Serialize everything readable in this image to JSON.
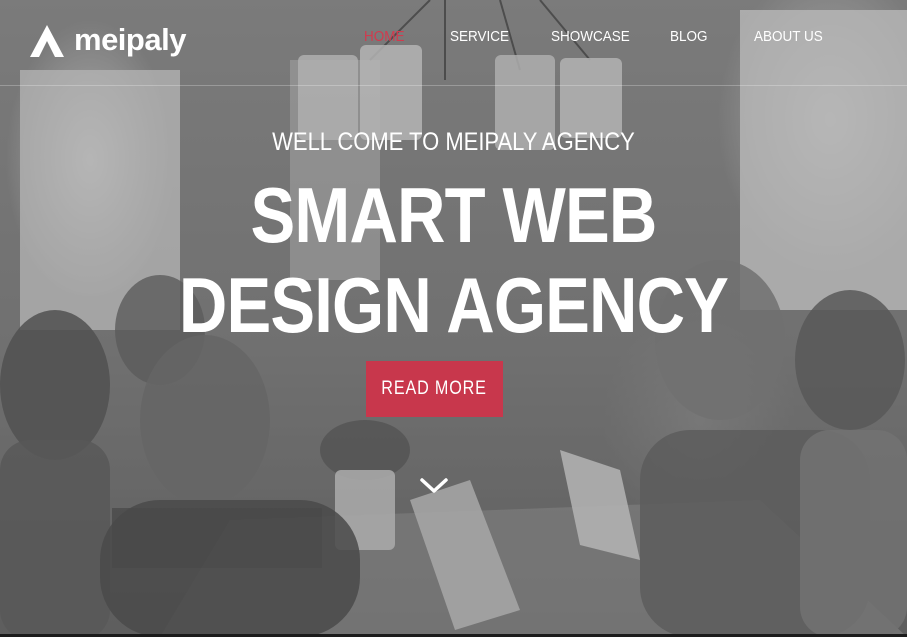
{
  "brand": {
    "name": "meipaly",
    "logo_icon": "triangle-logo-icon"
  },
  "nav": {
    "items": [
      {
        "label": "HOME",
        "active": true
      },
      {
        "label": "SERVICE",
        "active": false
      },
      {
        "label": "SHOWCASE",
        "active": false
      },
      {
        "label": "BLOG",
        "active": false
      },
      {
        "label": "ABOUT US",
        "active": false
      }
    ]
  },
  "hero": {
    "tagline": "WELL COME TO MEIPALY AGENCY",
    "headline_line1": "SMART WEB",
    "headline_line2": "DESIGN AGENCY",
    "cta_label": "READ MORE",
    "scroll_icon": "chevron-down-icon"
  },
  "colors": {
    "accent": "#c8374c",
    "nav_active": "#d23a4e",
    "text": "#ffffff"
  }
}
